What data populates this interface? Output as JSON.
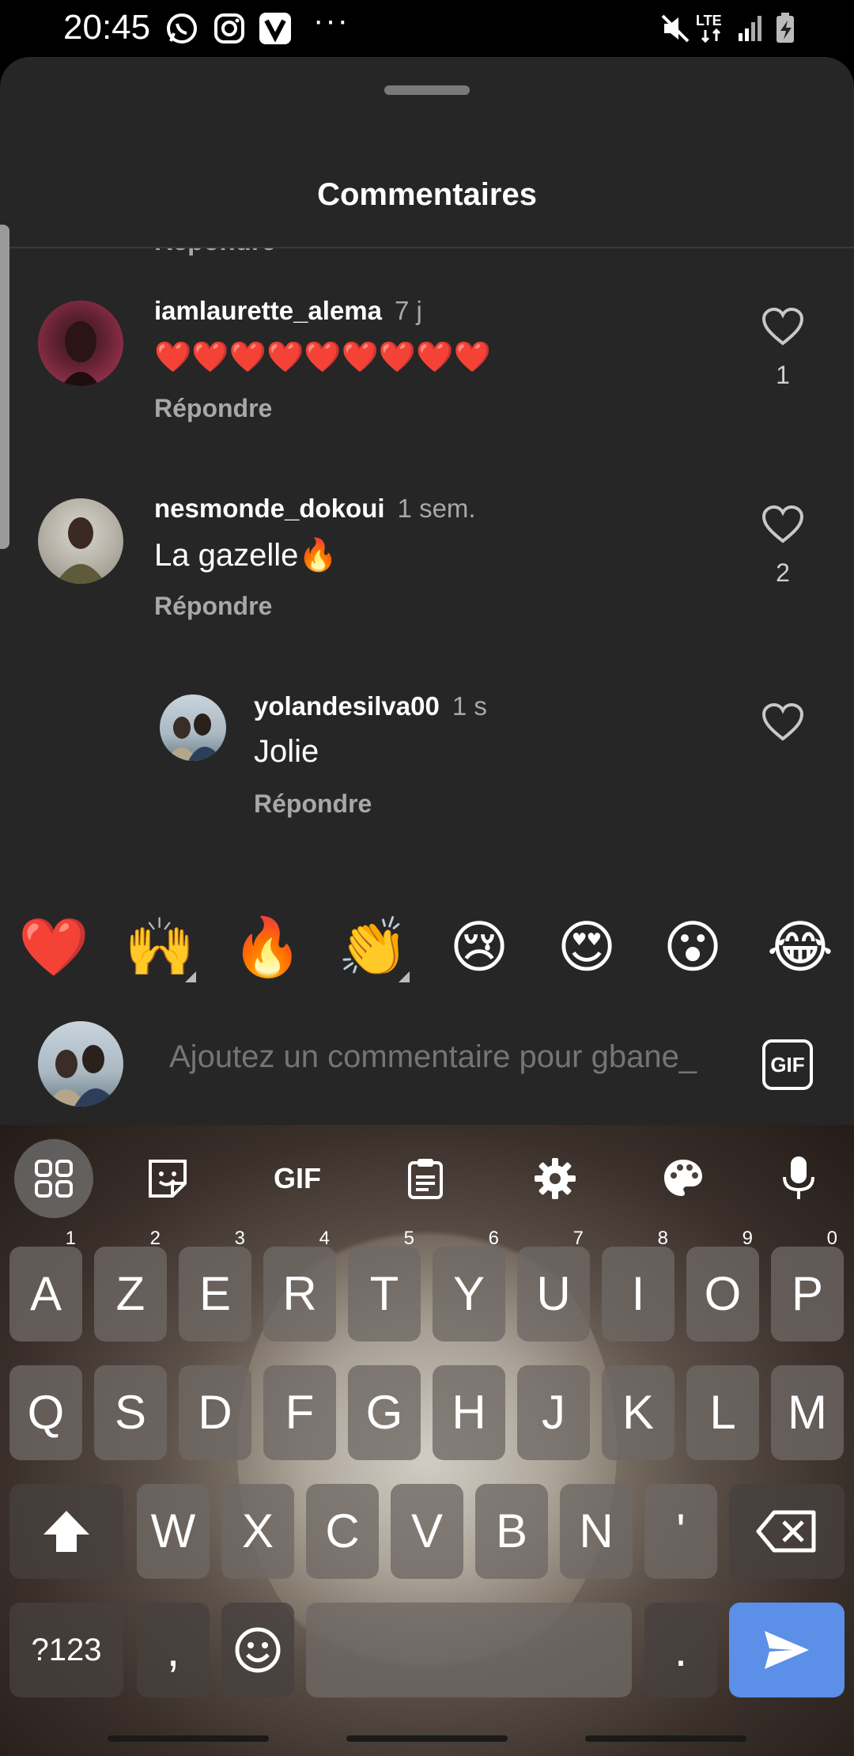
{
  "status_bar": {
    "time": "20:45",
    "network": "LTE"
  },
  "sheet": {
    "title": "Commentaires",
    "cut_reply": "Répondre"
  },
  "comments": [
    {
      "username": "iamlaurette_alema",
      "time": "7 j",
      "text": "❤️❤️❤️❤️❤️❤️❤️❤️❤️",
      "reply": "Répondre",
      "likes": "1"
    },
    {
      "username": "nesmonde_dokoui",
      "time": "1 sem.",
      "text": "La gazelle🔥",
      "reply": "Répondre",
      "likes": "2"
    },
    {
      "username": "yolandesilva00",
      "time": "1 s",
      "text": "Jolie",
      "reply": "Répondre",
      "likes": ""
    }
  ],
  "quick_emojis": [
    "❤️",
    "🙌",
    "🔥",
    "👏",
    "😢",
    "😍",
    "😮",
    "😂"
  ],
  "composer": {
    "placeholder": "Ajoutez un commentaire pour gbane_",
    "gif_label": "GIF"
  },
  "keyboard": {
    "toolbar_gif": "GIF",
    "row1": [
      "A",
      "Z",
      "E",
      "R",
      "T",
      "Y",
      "U",
      "I",
      "O",
      "P"
    ],
    "row1_hints": [
      "1",
      "2",
      "3",
      "4",
      "5",
      "6",
      "7",
      "8",
      "9",
      "0"
    ],
    "row2": [
      "Q",
      "S",
      "D",
      "F",
      "G",
      "H",
      "J",
      "K",
      "L",
      "M"
    ],
    "row3": [
      "W",
      "X",
      "C",
      "V",
      "B",
      "N",
      "'"
    ],
    "symbols_key": "?123",
    "comma_key": ",",
    "period_key": "."
  },
  "colors": {
    "sheet_bg": "#262626",
    "accent_send": "#5b8fe8",
    "heart_red": "#e0245e"
  }
}
